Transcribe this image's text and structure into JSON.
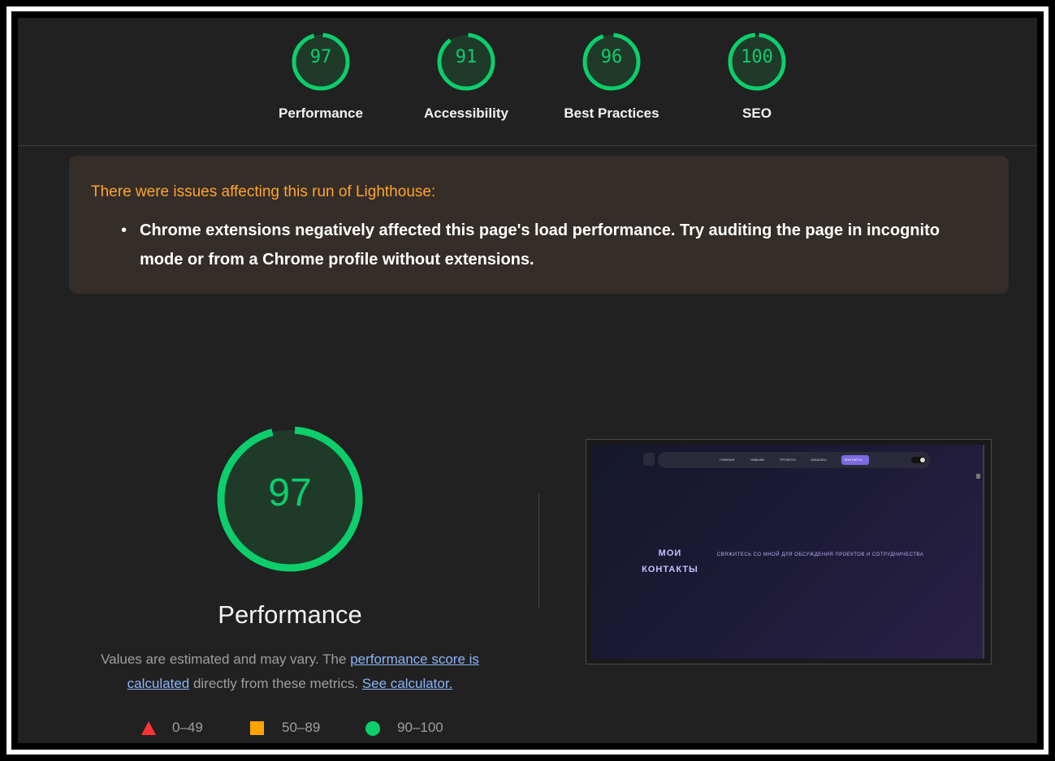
{
  "scores": [
    {
      "label": "Performance",
      "value": "97",
      "score": 0.97
    },
    {
      "label": "Accessibility",
      "value": "91",
      "score": 0.91
    },
    {
      "label": "Best Practices",
      "value": "96",
      "score": 0.96
    },
    {
      "label": "SEO",
      "value": "100",
      "score": 1.0
    }
  ],
  "warning": {
    "title": "There were issues affecting this run of Lighthouse:",
    "items": [
      "Chrome extensions negatively affected this page's load performance. Try auditing the page in incognito mode or from a Chrome profile without extensions."
    ]
  },
  "performance": {
    "score": "97",
    "score_fraction": 0.97,
    "label": "Performance",
    "desc_pre": "Values are estimated and may vary. The ",
    "desc_link1": "performance score is calculated",
    "desc_mid": " directly from these metrics. ",
    "desc_link2": "See calculator."
  },
  "legend": [
    {
      "range": "0–49",
      "shape": "triangle",
      "color": "#ff3333"
    },
    {
      "range": "50–89",
      "shape": "square",
      "color": "#ffa400"
    },
    {
      "range": "90–100",
      "shape": "circle",
      "color": "#0cce6b"
    }
  ],
  "screenshot": {
    "nav": [
      "ГЛАВНАЯ",
      "НАВЫКИ",
      "ПРОЕКТЫ",
      "ЗАКАЗАТЬ",
      "КОНТАКТЫ"
    ],
    "title_line1": "МОИ",
    "title_line2": "КОНТАКТЫ",
    "subtitle": "СВЯЖИТЕСЬ СО МНОЙ ДЛЯ ОБСУЖДЕНИЯ ПРОЕКТОВ И СОТРУДНИЧЕСТВА"
  },
  "colors": {
    "pass": "#0cce6b",
    "pass_bg": "#203a2a",
    "panel_bg": "#212121",
    "warning_text": "#ffa52d",
    "link": "#8ab4f8"
  }
}
